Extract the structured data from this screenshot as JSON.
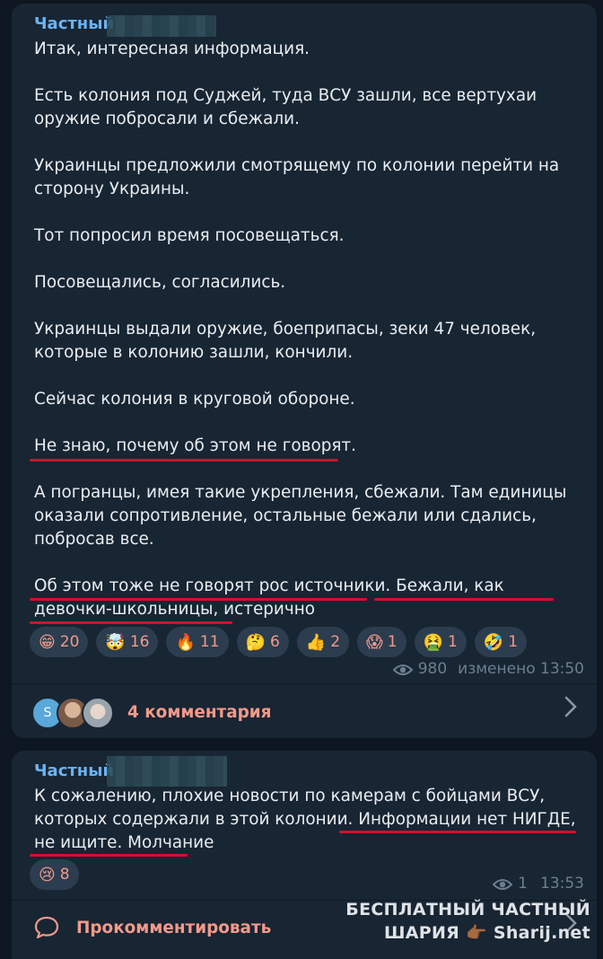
{
  "post1": {
    "sender": "Частный",
    "paragraphs": [
      "Итак, интересная информация.",
      "Есть колония под Суджей, туда ВСУ зашли, все вертухаи оружие побросали и сбежали.",
      "Украинцы предложили смотрящему по колонии перейти на сторону Украины.",
      "Тот попросил время посовещаться.",
      "Посовещались, согласились.",
      "Украинцы выдали оружие, боеприпасы, зеки 47 человек, которые в колонию зашли, кончили.",
      "Сейчас колония в круговой обороне.",
      "Не знаю, почему об этом не говорят.",
      "А погранцы, имея такие укрепления, сбежали. Там единицы оказали сопротивление, остальные бежали или сдались, побросав все.",
      "Об этом тоже не говорят рос источники. Бежали, как девочки-школьницы, истерично"
    ],
    "reactions": [
      {
        "emoji": "😁",
        "count": "20"
      },
      {
        "emoji": "🤯",
        "count": "16"
      },
      {
        "emoji": "🔥",
        "count": "11"
      },
      {
        "emoji": "🤔",
        "count": "6"
      },
      {
        "emoji": "👍",
        "count": "2"
      },
      {
        "emoji": "😱",
        "count": "1"
      },
      {
        "emoji": "🤮",
        "count": "1"
      },
      {
        "emoji": "🤣",
        "count": "1"
      }
    ],
    "views": "980",
    "edited_time": "изменено 13:50",
    "avatar_letter": "S",
    "comments_label": "4 комментария"
  },
  "post2": {
    "sender": "Частный",
    "text": "К сожалению, плохие новости по камерам с бойцами ВСУ, которых содержали в этой колонии. Информации нет НИГДЕ, не ищите. Молчание",
    "reactions": [
      {
        "emoji": "😢",
        "count": "8"
      }
    ],
    "views": "1",
    "time": "13:53",
    "comment_label": "Прокомментировать"
  },
  "watermark": {
    "line1": "БЕСПЛАТНЫЙ ЧАСТНЫЙ",
    "line2": "ШАРИЯ 👉🏾 Sharij.net"
  },
  "colors": {
    "background": "#0e1621",
    "bubble": "#182533",
    "sender": "#6ab3f3",
    "accent_link": "#f19a8a",
    "underline": "#d3102c"
  }
}
